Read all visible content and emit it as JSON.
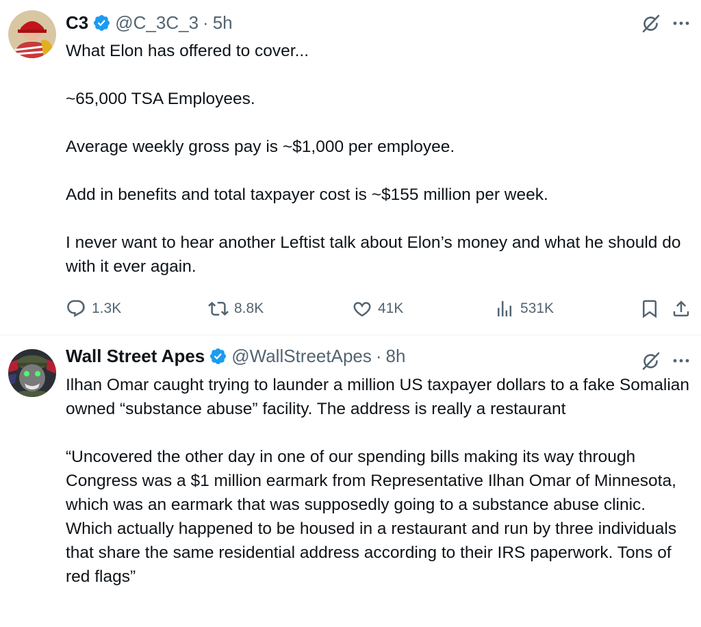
{
  "tweets": [
    {
      "name": "C3",
      "handle": "@C_3C_3",
      "separator": "·",
      "time": "5h",
      "text": "What Elon has offered to cover...\n\n~65,000 TSA Employees.\n\nAverage weekly gross pay is ~$1,000 per employee.\n\nAdd in benefits and total taxpayer cost is ~$155 million per week.\n\nI never want to hear another Leftist talk about Elon’s money and what he should do with it ever again.",
      "replies": "1.3K",
      "reposts": "8.8K",
      "likes": "41K",
      "views": "531K"
    },
    {
      "name": "Wall Street Apes",
      "handle": "@WallStreetApes",
      "separator": "·",
      "time": "8h",
      "text": "Ilhan Omar caught trying to launder a million US taxpayer dollars to a fake Somalian owned “substance abuse” facility. The address is really a restaurant\n\n“Uncovered the other day in one of our spending bills making its way through Congress was a $1 million earmark from Representative Ilhan Omar of Minnesota, which was an earmark that was supposedly going to a substance abuse clinic. Which actually happened to be housed in a restaurant and run by three individuals that share the same residential address according to their IRS paperwork. Tons of red flags”"
    }
  ],
  "colors": {
    "text": "#0f1419",
    "secondary": "#536471",
    "verified": "#1d9bf0",
    "divider": "#eff3f4"
  },
  "icons": [
    "verified-badge-icon",
    "grok-icon",
    "more-icon",
    "reply-icon",
    "repost-icon",
    "like-icon",
    "views-icon",
    "bookmark-icon",
    "share-icon"
  ]
}
